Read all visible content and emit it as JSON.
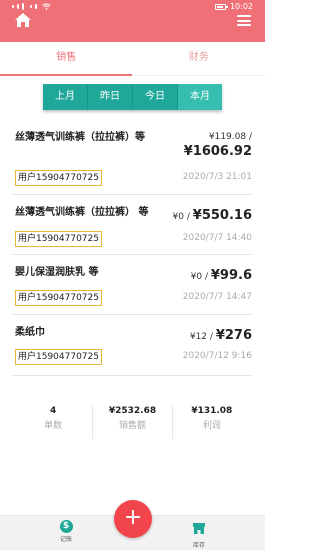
{
  "status": {
    "time": "10:02"
  },
  "tabs": [
    {
      "label": "销售",
      "active": true
    },
    {
      "label": "财务",
      "active": false
    }
  ],
  "periods": [
    {
      "label": "上月",
      "active": false
    },
    {
      "label": "昨日",
      "active": false
    },
    {
      "label": "今日",
      "active": false
    },
    {
      "label": "本月",
      "active": true
    }
  ],
  "records": [
    {
      "name": "丝薄透气训练裤（拉拉裤）等",
      "small": "¥119.08 /",
      "big": "¥1606.92",
      "user": "用户15904770725",
      "date": "2020/7/3 21:01"
    },
    {
      "name": "丝薄透气训练裤（拉拉裤） 等",
      "small": "¥0 /",
      "big": "¥550.16",
      "user": "用户15904770725",
      "date": "2020/7/7 14:40"
    },
    {
      "name": "婴儿保湿润肤乳 等",
      "small": "¥0 /",
      "big": "¥99.6",
      "user": "用户15904770725",
      "date": "2020/7/7 14:47"
    },
    {
      "name": "柔纸巾",
      "small": "¥12 /",
      "big": "¥276",
      "user": "用户15904770725",
      "date": "2020/7/12 9:16"
    }
  ],
  "summary": [
    {
      "value": "4",
      "label": "单数"
    },
    {
      "value": "¥2532.68",
      "label": "销售额"
    },
    {
      "value": "¥131.08",
      "label": "利润"
    }
  ],
  "bottom_nav": {
    "left_label": "记账",
    "right_label": "库存",
    "fab_label": "+"
  },
  "colors": {
    "brand": "#f07078",
    "teal": "#1fa79a",
    "fab": "#f1454b",
    "user_border": "#e6b93a"
  }
}
